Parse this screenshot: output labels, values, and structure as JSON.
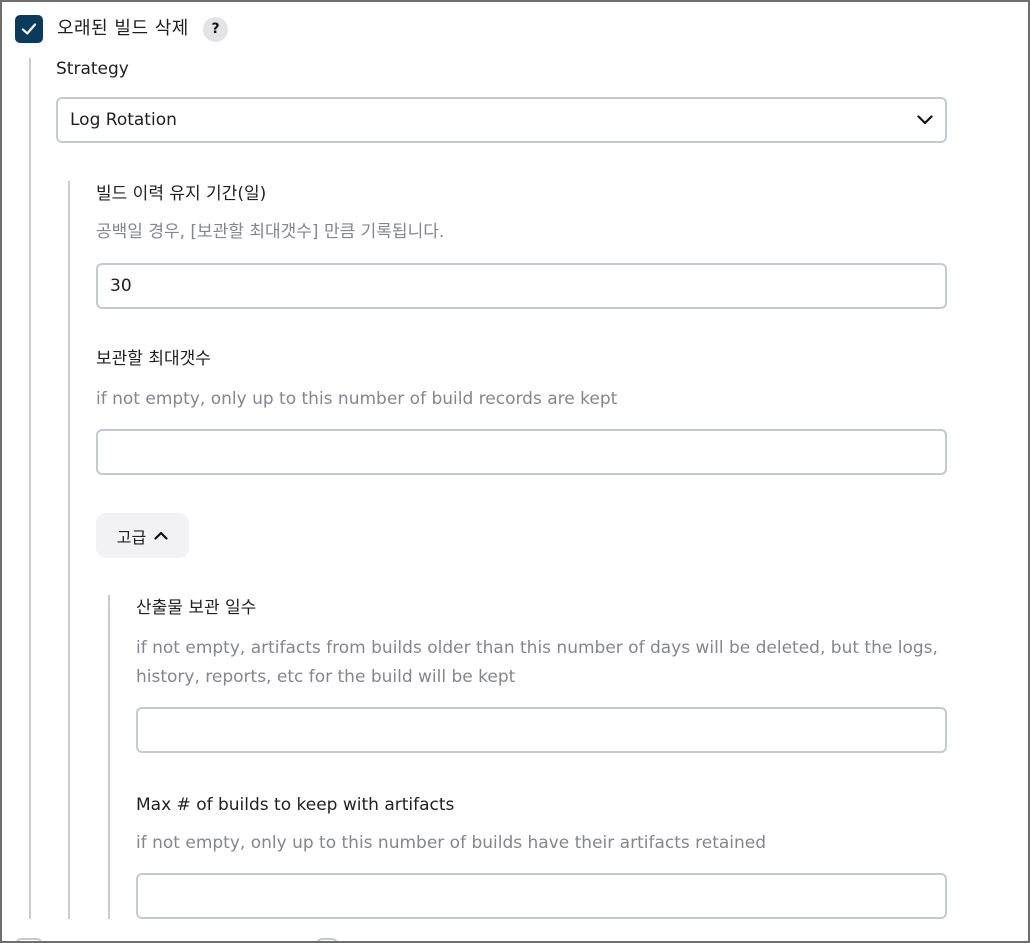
{
  "section": {
    "title": "오래된 빌드 삭제",
    "enabled": true,
    "help_glyph": "?"
  },
  "strategy": {
    "label": "Strategy",
    "selected": "Log Rotation"
  },
  "days_to_keep": {
    "label": "빌드 이력 유지 기간(일)",
    "description": "공백일 경우, [보관할 최대갯수] 만큼 기록됩니다.",
    "value": "30"
  },
  "num_to_keep": {
    "label": "보관할 최대갯수",
    "description": "if not empty, only up to this number of build records are kept",
    "value": ""
  },
  "advanced": {
    "label": "고급",
    "expanded": true
  },
  "artifact_days": {
    "label": "산출물 보관 일수",
    "description_line1": "if not empty, artifacts from builds older than this number of days will be deleted, but the logs,",
    "description_line2": "history, reports, etc for the build will be kept",
    "value": ""
  },
  "artifact_num": {
    "label": "Max # of builds to keep with artifacts",
    "description": "if not empty, only up to this number of builds have their artifacts retained",
    "value": ""
  },
  "colors": {
    "checkbox": "#0b3b5c",
    "border": "#c4cbd0",
    "muted_text": "#83868c"
  }
}
